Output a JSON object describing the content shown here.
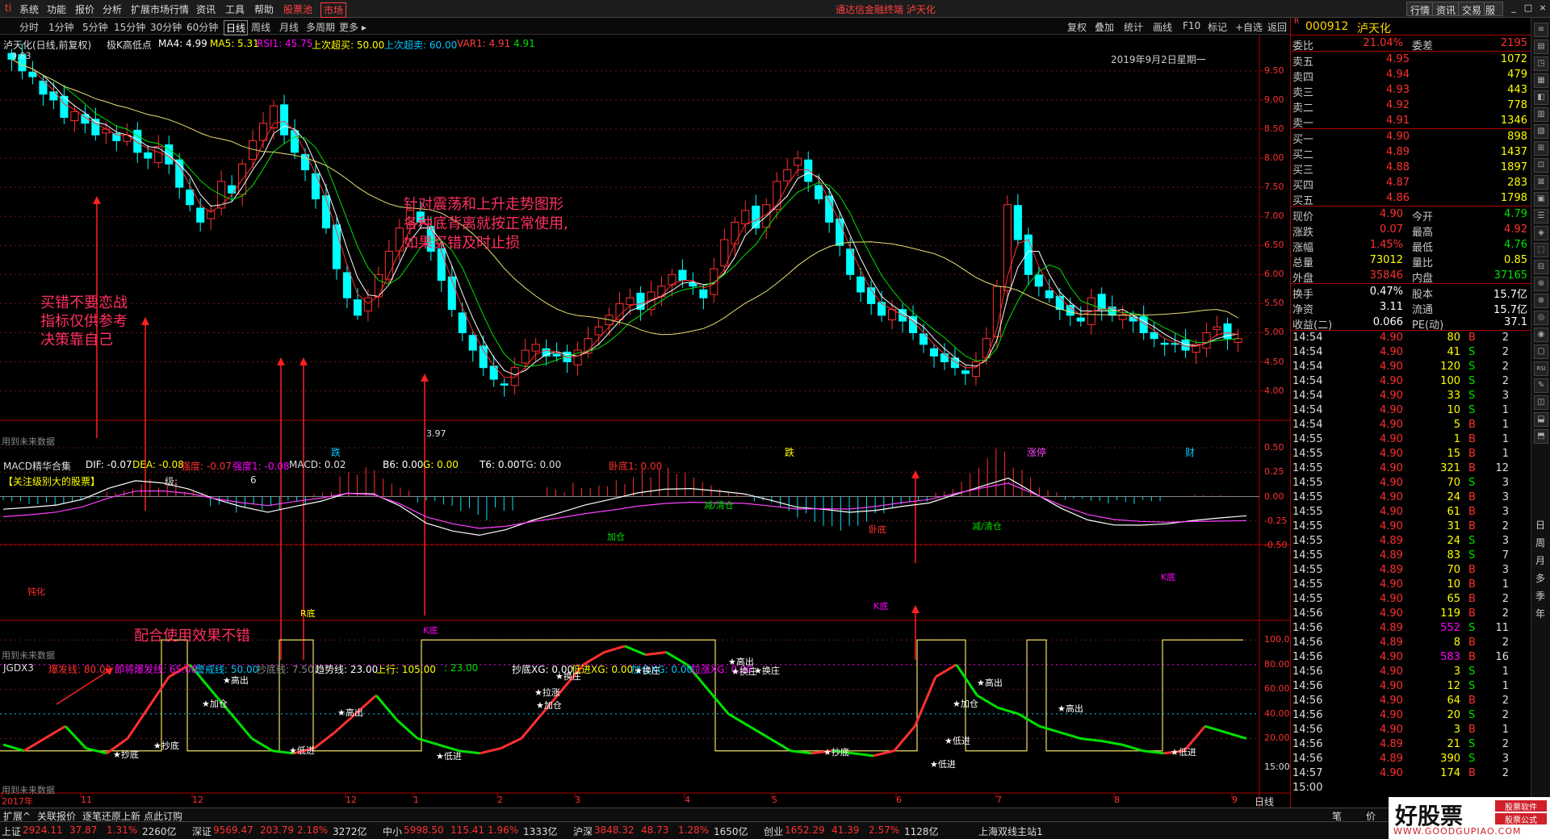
{
  "menubar": {
    "logo": "ti",
    "items": [
      "系统",
      "功能",
      "报价",
      "分析",
      "扩展市场行情",
      "资讯",
      "工具",
      "帮助"
    ],
    "highlight_items": [
      "股票池",
      "市场"
    ],
    "title": "通达信金融终端  泸天化",
    "right_buttons": [
      "行情",
      "资讯",
      "交易",
      "服务"
    ],
    "window_controls": [
      "_",
      "□",
      "×"
    ]
  },
  "periodbar": {
    "periods": [
      "分时",
      "1分钟",
      "5分钟",
      "15分钟",
      "30分钟",
      "60分钟",
      "日线",
      "周线",
      "月线",
      "多周期",
      "更多 ▸"
    ],
    "active": "日线",
    "tools": [
      "复权",
      "叠加",
      "统计",
      "画线",
      "F10",
      "标记",
      "+自选",
      "返回"
    ]
  },
  "main_chart": {
    "header_name": "泸天化(日线,前复权)",
    "indicator_name": "极K高低点",
    "ma4": "MA4: 4.99",
    "ma5": "MA5: 5.31",
    "rsi1": "RSI1: 45.75",
    "up_buy": "上次超买: 50.00",
    "up_sell": "上次超卖: 60.00",
    "var1": "VAR1: 4.91",
    "var1b": "4.91",
    "date": "2019年9月2日星期一",
    "high_label": "9.83",
    "low_label": "3.97",
    "future_note": "用到未来数据",
    "annot_1": "买错不要恋战",
    "annot_2": "指标仅供参考",
    "annot_3": "决策靠自己",
    "annot_4": "针对震荡和上升走势图形",
    "annot_5": "各种底背离就按正常使用,",
    "annot_6": "如果买错及时止损",
    "markers": [
      "跌",
      "跌",
      "涨停",
      "财"
    ],
    "y_ticks": [
      "9.50",
      "9.00",
      "8.50",
      "8.00",
      "7.50",
      "7.00",
      "6.50",
      "6.00",
      "5.50",
      "5.00",
      "4.50",
      "4.00"
    ]
  },
  "macd_panel": {
    "title": "MACD精华合集",
    "dif": "DIF: -0.07",
    "dea": "DEA: -0.08",
    "strength": "强度: -0.07",
    "strength1": "强度1: -0.08",
    "macd": "MACD: 0.02",
    "b6": "B6: 0.00",
    "g": "G: 0.00",
    "t6": "T6: 0.00",
    "tg": "TG: 0.00",
    "wodi": "卧底1: 0.00",
    "level_label": "【关注级别大的股票】",
    "level_key": "级:",
    "level_val": "6",
    "annot": "配合使用效果不错",
    "future_note": "用到未来数据",
    "labels": [
      "钝化",
      "R底",
      "K底",
      "卧底",
      "K底",
      "减/清仓",
      "加仓",
      "减/清仓",
      "K底"
    ],
    "y_ticks": [
      "0.50",
      "0.25",
      "0.00",
      "-0.25",
      "-0.50"
    ]
  },
  "jgdx_panel": {
    "title": "JGDX3",
    "burst": "爆发线: 80.00",
    "near_burst": "即将爆发线: 65.00",
    "alert": "警戒线: 50.00",
    "bottom_line": "抄底线: 7.50",
    "trend": "趋势线: 23.00",
    "up": "上行: 105.00",
    "up2": ": 23.00",
    "bottom_xg": "抄底XG: 0.00",
    "low_in": "低进XG: 0.00",
    "add_xg": "加仓XG: 0.00",
    "rise_xg": "拉涨XG: 0.00",
    "future_note": "用到未来数据",
    "labels": [
      "抄底",
      "抄底",
      "加仓",
      "高出",
      "低进",
      "高出",
      "低进",
      "拉涨",
      "加仓",
      "换庄",
      "换庄",
      "换庄",
      "高出",
      "换庄",
      "抄底",
      "低进",
      "加仓",
      "低进",
      "高出",
      "高出",
      "低进"
    ],
    "y_ticks": [
      "100.0",
      "80.00",
      "60.00",
      "40.00",
      "20.00"
    ],
    "y_ticks_partial": "15:00"
  },
  "x_axis": {
    "labels": [
      "2017年",
      "11",
      "12",
      "12",
      "1",
      "2",
      "3",
      "4",
      "5",
      "6",
      "7",
      "8",
      "9"
    ],
    "period": "日线"
  },
  "quote": {
    "code": "000912",
    "name": "泸天化",
    "badge": "R",
    "ratio": {
      "label": "委比",
      "value": "21.04%",
      "label2": "委差",
      "value2": "2195"
    },
    "asks": [
      {
        "label": "卖五",
        "price": "4.95",
        "vol": "1072"
      },
      {
        "label": "卖四",
        "price": "4.94",
        "vol": "479"
      },
      {
        "label": "卖三",
        "price": "4.93",
        "vol": "443"
      },
      {
        "label": "卖二",
        "price": "4.92",
        "vol": "778"
      },
      {
        "label": "卖一",
        "price": "4.91",
        "vol": "1346"
      }
    ],
    "bids": [
      {
        "label": "买一",
        "price": "4.90",
        "vol": "898"
      },
      {
        "label": "买二",
        "price": "4.89",
        "vol": "1437"
      },
      {
        "label": "买三",
        "price": "4.88",
        "vol": "1897"
      },
      {
        "label": "买四",
        "price": "4.87",
        "vol": "283"
      },
      {
        "label": "买五",
        "price": "4.86",
        "vol": "1798"
      }
    ],
    "stats": [
      {
        "l": "现价",
        "v": "4.90",
        "vc": "red",
        "l2": "今开",
        "v2": "4.79",
        "v2c": "green"
      },
      {
        "l": "涨跌",
        "v": "0.07",
        "vc": "red",
        "l2": "最高",
        "v2": "4.92",
        "v2c": "red"
      },
      {
        "l": "涨幅",
        "v": "1.45%",
        "vc": "red",
        "l2": "最低",
        "v2": "4.76",
        "v2c": "green"
      },
      {
        "l": "总量",
        "v": "73012",
        "vc": "yellow",
        "l2": "量比",
        "v2": "0.85",
        "v2c": "yellow"
      },
      {
        "l": "外盘",
        "v": "35846",
        "vc": "red",
        "l2": "内盘",
        "v2": "37165",
        "v2c": "green"
      }
    ],
    "stats2": [
      {
        "l": "换手",
        "v": "0.47%",
        "l2": "股本",
        "v2": "15.7亿"
      },
      {
        "l": "净资",
        "v": "3.11",
        "l2": "流通",
        "v2": "15.7亿"
      },
      {
        "l": "收益(二)",
        "v": "0.066",
        "l2": "PE(动)",
        "v2": "37.1"
      }
    ],
    "ticks": [
      {
        "t": "14:54",
        "p": "4.90",
        "v": "80",
        "bs": "B",
        "n": "2"
      },
      {
        "t": "14:54",
        "p": "4.90",
        "v": "41",
        "bs": "S",
        "n": "2"
      },
      {
        "t": "14:54",
        "p": "4.90",
        "v": "120",
        "bs": "S",
        "n": "2"
      },
      {
        "t": "14:54",
        "p": "4.90",
        "v": "100",
        "bs": "S",
        "n": "2"
      },
      {
        "t": "14:54",
        "p": "4.90",
        "v": "33",
        "bs": "S",
        "n": "3"
      },
      {
        "t": "14:54",
        "p": "4.90",
        "v": "10",
        "bs": "S",
        "n": "1"
      },
      {
        "t": "14:54",
        "p": "4.90",
        "v": "5",
        "bs": "B",
        "n": "1"
      },
      {
        "t": "14:55",
        "p": "4.90",
        "v": "1",
        "bs": "B",
        "n": "1"
      },
      {
        "t": "14:55",
        "p": "4.90",
        "v": "15",
        "bs": "B",
        "n": "1"
      },
      {
        "t": "14:55",
        "p": "4.90",
        "v": "321",
        "bs": "B",
        "n": "12"
      },
      {
        "t": "14:55",
        "p": "4.90",
        "v": "70",
        "bs": "S",
        "n": "3"
      },
      {
        "t": "14:55",
        "p": "4.90",
        "v": "24",
        "bs": "B",
        "n": "3"
      },
      {
        "t": "14:55",
        "p": "4.90",
        "v": "61",
        "bs": "B",
        "n": "3"
      },
      {
        "t": "14:55",
        "p": "4.90",
        "v": "31",
        "bs": "B",
        "n": "2"
      },
      {
        "t": "14:55",
        "p": "4.89",
        "v": "24",
        "bs": "S",
        "n": "3"
      },
      {
        "t": "14:55",
        "p": "4.89",
        "v": "83",
        "bs": "S",
        "n": "7"
      },
      {
        "t": "14:55",
        "p": "4.89",
        "v": "70",
        "bs": "B",
        "n": "3"
      },
      {
        "t": "14:55",
        "p": "4.90",
        "v": "10",
        "bs": "B",
        "n": "1"
      },
      {
        "t": "14:55",
        "p": "4.90",
        "v": "65",
        "bs": "B",
        "n": "2"
      },
      {
        "t": "14:56",
        "p": "4.90",
        "v": "119",
        "bs": "B",
        "n": "2"
      },
      {
        "t": "14:56",
        "p": "4.89",
        "v": "552",
        "bs": "S",
        "n": "11"
      },
      {
        "t": "14:56",
        "p": "4.89",
        "v": "8",
        "bs": "B",
        "n": "2"
      },
      {
        "t": "14:56",
        "p": "4.90",
        "v": "583",
        "bs": "B",
        "n": "16"
      },
      {
        "t": "14:56",
        "p": "4.90",
        "v": "3",
        "bs": "S",
        "n": "1"
      },
      {
        "t": "14:56",
        "p": "4.90",
        "v": "12",
        "bs": "S",
        "n": "1"
      },
      {
        "t": "14:56",
        "p": "4.90",
        "v": "64",
        "bs": "B",
        "n": "2"
      },
      {
        "t": "14:56",
        "p": "4.90",
        "v": "20",
        "bs": "S",
        "n": "2"
      },
      {
        "t": "14:56",
        "p": "4.90",
        "v": "3",
        "bs": "B",
        "n": "1"
      },
      {
        "t": "14:56",
        "p": "4.89",
        "v": "21",
        "bs": "S",
        "n": "2"
      },
      {
        "t": "14:56",
        "p": "4.89",
        "v": "390",
        "bs": "S",
        "n": "3"
      },
      {
        "t": "14:57",
        "p": "4.90",
        "v": "174",
        "bs": "B",
        "n": "2"
      },
      {
        "t": "15:00",
        "p": "",
        "v": "",
        "bs": "",
        "n": ""
      }
    ]
  },
  "sidebar": {
    "chars": [
      "日",
      "周",
      "月",
      "多",
      "季",
      "年"
    ]
  },
  "bottomtabs": {
    "items": [
      "扩展^",
      "关联报价",
      "逐笔还原上新",
      "点此订购"
    ],
    "quote_tabs": [
      "笔",
      "价",
      "细"
    ]
  },
  "statusbar": {
    "items": [
      {
        "n": "上证",
        "v": "2924.11",
        "c": "37.87",
        "p": "1.31%",
        "a": "2260亿"
      },
      {
        "n": "深证",
        "v": "9569.47",
        "c": "203.79",
        "p": "2.18%",
        "a": "3272亿"
      },
      {
        "n": "中小",
        "v": "5998.50",
        "c": "115.41",
        "p": "1.96%",
        "a": "1333亿"
      },
      {
        "n": "沪深",
        "v": "3848.32",
        "c": "48.73",
        "p": "1.28%",
        "a": "1650亿"
      },
      {
        "n": "创业",
        "v": "1652.29",
        "c": "41.39",
        "p": "2.57%",
        "a": "1128亿"
      }
    ],
    "server": "上海双线主站1"
  },
  "watermark": {
    "brand": "好股票",
    "tag1": "股票软件",
    "tag2": "股票公式",
    "url": "WWW.GOODGUPIAO.COM"
  },
  "chart_data": {
    "type": "candlestick",
    "title": "泸天化(日线,前复权)",
    "price_range": [
      3.8,
      9.9
    ],
    "candles": [
      9.7,
      9.5,
      9.4,
      9.1,
      9.0,
      8.7,
      8.8,
      8.6,
      8.4,
      8.5,
      8.3,
      8.4,
      8.1,
      8.0,
      8.2,
      7.9,
      7.5,
      7.2,
      6.9,
      7.1,
      7.6,
      7.4,
      7.9,
      8.3,
      8.6,
      8.9,
      8.4,
      8.1,
      7.8,
      7.3,
      6.8,
      6.1,
      5.6,
      5.3,
      5.6,
      6.0,
      6.4,
      6.8,
      7.1,
      6.9,
      6.4,
      5.9,
      5.4,
      5.0,
      4.7,
      4.4,
      4.2,
      4.1,
      4.4,
      4.7,
      4.8,
      4.6,
      4.6,
      4.5,
      4.7,
      4.9,
      5.1,
      5.3,
      5.5,
      5.6,
      5.4,
      5.7,
      5.8,
      6.0,
      5.9,
      5.8,
      5.6,
      6.1,
      6.6,
      6.9,
      7.1,
      6.8,
      7.2,
      7.6,
      7.8,
      8.0,
      7.6,
      7.3,
      6.9,
      6.5,
      6.0,
      5.7,
      5.5,
      5.3,
      5.4,
      5.2,
      5.0,
      4.8,
      4.6,
      4.5,
      4.4,
      4.3,
      4.5,
      4.9,
      5.8,
      7.2,
      6.6,
      6.0,
      5.8,
      5.6,
      5.4,
      5.3,
      5.2,
      5.6,
      5.4,
      5.3,
      5.3,
      5.2,
      5.0,
      4.9,
      4.8,
      4.8,
      4.7,
      4.8,
      5.0,
      5.1,
      4.9,
      4.9
    ],
    "macd_hist": [
      -0.05,
      -0.08,
      -0.1,
      -0.05,
      0.1,
      0.2,
      0.15,
      0.05,
      -0.1,
      -0.2,
      -0.25,
      -0.1,
      0.05,
      0.25,
      0.3,
      0.15,
      -0.1,
      -0.2,
      -0.25,
      -0.15,
      0.0,
      0.1,
      0.2,
      0.25,
      0.3,
      0.3,
      0.25,
      0.15,
      0.05,
      -0.1,
      -0.25,
      -0.3,
      -0.35,
      -0.3,
      -0.2,
      -0.1,
      0.1,
      0.3,
      0.5,
      0.3,
      0.1,
      -0.05,
      -0.1,
      -0.08,
      -0.05,
      0.0,
      0.02,
      0.02
    ],
    "jgdx_line": [
      15,
      10,
      20,
      30,
      12,
      8,
      20,
      45,
      70,
      80,
      60,
      40,
      20,
      10,
      8,
      12,
      25,
      40,
      55,
      35,
      20,
      15,
      10,
      8,
      12,
      20,
      40,
      60,
      80,
      90,
      95,
      88,
      90,
      80,
      60,
      40,
      30,
      20,
      10,
      8,
      10,
      8,
      6,
      10,
      30,
      70,
      80,
      55,
      45,
      40,
      30,
      25,
      20,
      18,
      15,
      10,
      8,
      10,
      30,
      25,
      20
    ]
  }
}
